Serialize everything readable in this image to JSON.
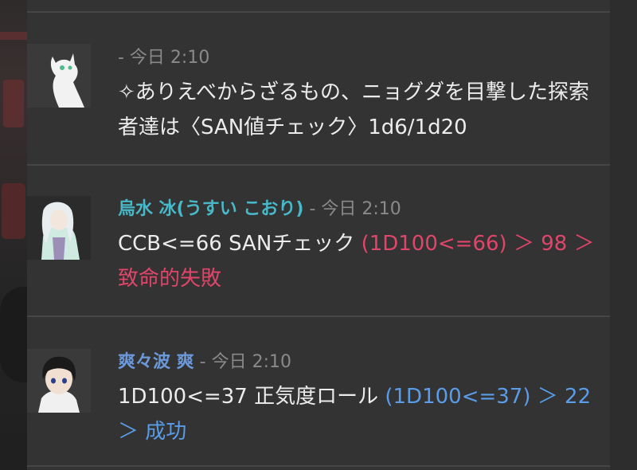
{
  "messages": [
    {
      "name": "",
      "name_color": "#cccccc",
      "time": "- 今日 2:10",
      "text": "✧ありえべからざるもの、ニョグダを目撃した探索者達は〈SAN値チェック〉1d6/1d20",
      "result": "",
      "result_color": "",
      "avatar_icon": "white-cat-icon"
    },
    {
      "name": "烏水 冰(うすい こおり)",
      "name_color": "#48b9c9",
      "time": "- 今日 2:10",
      "text": "CCB<=66 SANチェック ",
      "result": "(1D100<=66) ＞ 98 ＞ 致命的失敗",
      "result_color": "#e0456a",
      "avatar_icon": "white-haired-character-icon"
    },
    {
      "name": "爽々波 爽",
      "name_color": "#6a98d8",
      "time": "- 今日 2:10",
      "text": "1D100<=37 正気度ロール ",
      "result": "(1D100<=37) ＞ 22 ＞ 成功",
      "result_color": "#5a9ce8",
      "avatar_icon": "black-haired-character-icon"
    }
  ]
}
